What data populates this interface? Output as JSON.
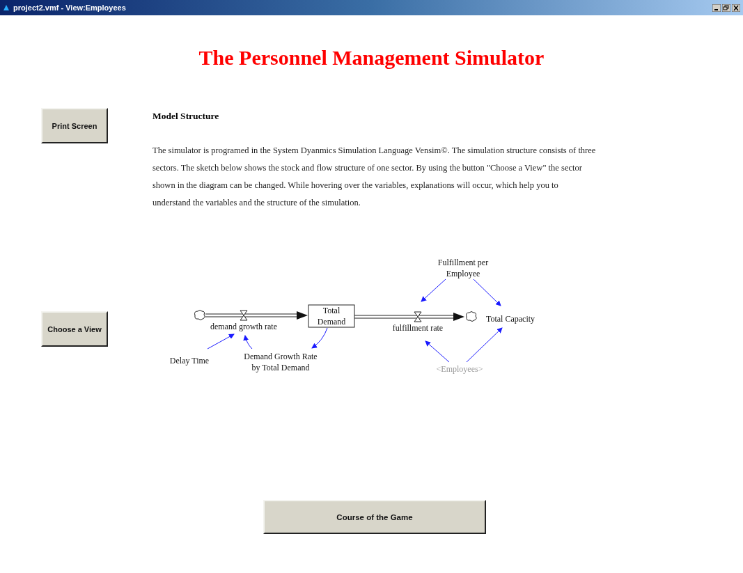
{
  "window": {
    "title": "project2.vmf - View:Employees"
  },
  "title": "The Personnel Management Simulator",
  "buttons": {
    "print": "Print Screen",
    "view": "Choose a View",
    "course": "Course of the Game"
  },
  "section": {
    "heading": "Model Structure",
    "text": "The simulator is programed in the System Dyanmics Simulation Language Vensim©. The simulation structure consists of three sectors. The sketch below shows the stock and flow structure of one sector. By using the button \"Choose a View\" the sector shown in the diagram can be changed. While hovering over the variables, explanations will occur, which help you to understand the variables and the structure of the simulation."
  },
  "diagram": {
    "labels": [
      {
        "kind": "rate",
        "lines": [
          "demand growth rate"
        ]
      },
      {
        "kind": "stock",
        "lines": [
          "Total",
          "Demand"
        ]
      },
      {
        "kind": "rate",
        "lines": [
          "fulfillment rate"
        ]
      },
      {
        "kind": "variable",
        "lines": [
          "Total Capacity"
        ]
      },
      {
        "kind": "variable",
        "lines": [
          "Fulfillment per",
          "Employee"
        ]
      },
      {
        "kind": "variable",
        "lines": [
          "Delay Time"
        ]
      },
      {
        "kind": "variable",
        "lines": [
          "Demand Growth Rate",
          "by Total Demand"
        ]
      },
      {
        "kind": "shadow",
        "lines": [
          "<Employees>"
        ]
      }
    ]
  }
}
